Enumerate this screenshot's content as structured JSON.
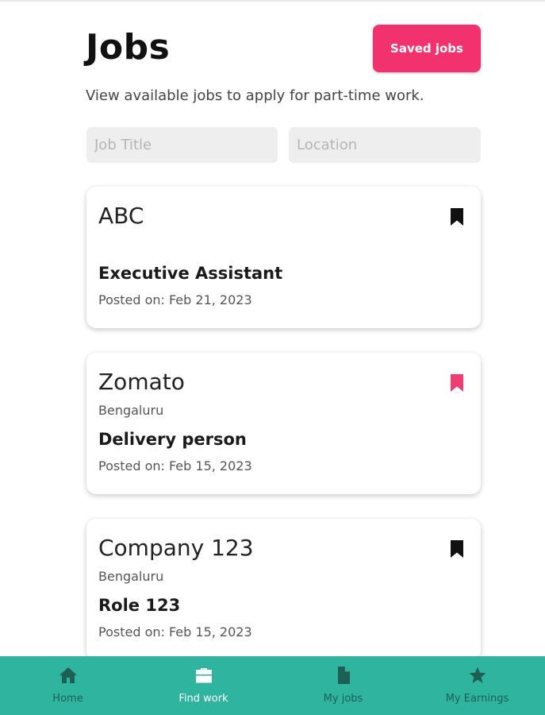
{
  "header": {
    "title": "Jobs",
    "saved_jobs_label": "Saved jobs",
    "subtitle": "View available jobs to apply for part-time work."
  },
  "search": {
    "job_title_placeholder": "Job Title",
    "job_title_value": "",
    "location_placeholder": "Location",
    "location_value": ""
  },
  "jobs": [
    {
      "company": "ABC",
      "location": "",
      "role": "Executive Assistant",
      "posted": "Posted on: Feb 21, 2023",
      "bookmark_icon": "bookmark-icon",
      "bookmark_color": "#111111",
      "saved": false
    },
    {
      "company": "Zomato",
      "location": "Bengaluru",
      "role": "Delivery person",
      "posted": "Posted on: Feb 15, 2023",
      "bookmark_icon": "bookmark-icon",
      "bookmark_color": "#ef3d74",
      "saved": true
    },
    {
      "company": "Company 123",
      "location": "Bengaluru",
      "role": "Role 123",
      "posted": "Posted on: Feb 15, 2023",
      "bookmark_icon": "bookmark-icon",
      "bookmark_color": "#111111",
      "saved": false
    }
  ],
  "nav": {
    "items": [
      {
        "label": "Home",
        "icon": "home-icon",
        "active": false
      },
      {
        "label": "Find work",
        "icon": "briefcase-icon",
        "active": true
      },
      {
        "label": "My jobs",
        "icon": "document-icon",
        "active": false
      },
      {
        "label": "My Earnings",
        "icon": "star-icon",
        "active": false
      }
    ],
    "background_color": "#2fb59f",
    "icon_color": "#1e5f55",
    "active_color": "#ffffff"
  },
  "colors": {
    "accent": "#f2326f"
  }
}
